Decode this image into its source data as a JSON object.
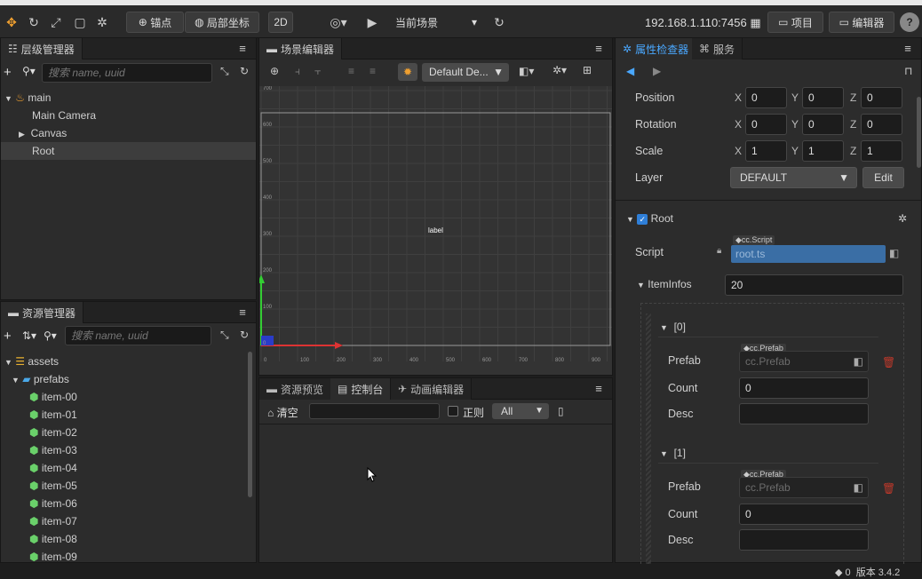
{
  "toolbar": {
    "anchor": "锚点",
    "local_coords": "局部坐标",
    "mode_2d": "2D",
    "scene": "当前场景",
    "ip": "192.168.1.110:7456",
    "project": "项目",
    "editor": "编辑器",
    "help": "?"
  },
  "hierarchy": {
    "title": "层级管理器",
    "search_placeholder": "搜索 name, uuid",
    "items": [
      "main",
      "Main Camera",
      "Canvas",
      "Root"
    ]
  },
  "scene": {
    "title": "场景编辑器",
    "camera": "Default De...",
    "label": "label",
    "y_ticks": [
      "700",
      "600",
      "500",
      "400",
      "300",
      "200",
      "100",
      "0"
    ],
    "x_ticks": [
      "0",
      "100",
      "200",
      "300",
      "400",
      "500",
      "600",
      "700",
      "800",
      "900"
    ]
  },
  "assets": {
    "title": "资源管理器",
    "search_placeholder": "搜索 name, uuid",
    "root": "assets",
    "folder": "prefabs",
    "items": [
      "item-00",
      "item-01",
      "item-02",
      "item-03",
      "item-04",
      "item-05",
      "item-06",
      "item-07",
      "item-08",
      "item-09"
    ]
  },
  "bottom": {
    "tab1": "资源预览",
    "tab2": "控制台",
    "tab3": "动画编辑器",
    "clear": "清空",
    "regex": "正则",
    "filter": "All"
  },
  "inspector": {
    "tab1": "属性检查器",
    "tab2": "服务",
    "position_label": "Position",
    "rotation_label": "Rotation",
    "scale_label": "Scale",
    "layer_label": "Layer",
    "x": "X",
    "y": "Y",
    "z": "Z",
    "position": [
      "0",
      "0",
      "0"
    ],
    "rotation": [
      "0",
      "0",
      "0"
    ],
    "scale": [
      "1",
      "1",
      "1"
    ],
    "layer": "DEFAULT",
    "edit": "Edit",
    "component": "Root",
    "script_label": "Script",
    "script_tag": "cc.Script",
    "script_value": "root.ts",
    "iteminfos_label": "ItemInfos",
    "iteminfos_count": "20",
    "entries": [
      {
        "index": "[0]",
        "prefab_label": "Prefab",
        "prefab_tag": "cc.Prefab",
        "prefab_value": "cc.Prefab",
        "count_label": "Count",
        "count": "0",
        "desc_label": "Desc"
      },
      {
        "index": "[1]",
        "prefab_label": "Prefab",
        "prefab_tag": "cc.Prefab",
        "prefab_value": "cc.Prefab",
        "count_label": "Count",
        "count": "0",
        "desc_label": "Desc"
      }
    ]
  },
  "colors": {
    "accent": "#2f7fd8",
    "selected_row": "#3d3d3d",
    "script_field": "#3a6ea5",
    "delete": "#c0392b"
  }
}
